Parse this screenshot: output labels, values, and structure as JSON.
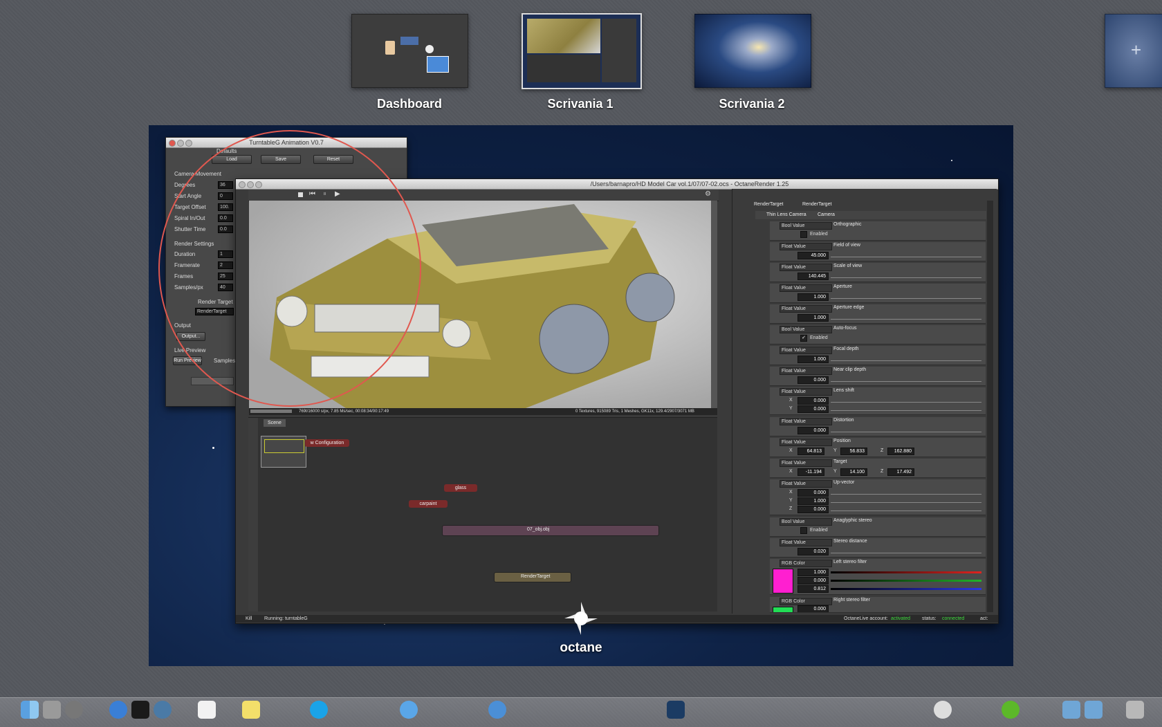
{
  "spaces": [
    {
      "label": "Dashboard"
    },
    {
      "label": "Scrivania 1"
    },
    {
      "label": "Scrivania 2"
    }
  ],
  "turntable": {
    "title": "TurntableG Animation V0.7",
    "defaults_label": "Defaults",
    "buttons": [
      "Load",
      "Save",
      "Reset"
    ],
    "camera_movement_label": "Camera Movement",
    "camera_fields": [
      {
        "label": "Degrees",
        "value": "36"
      },
      {
        "label": "Start Angle",
        "value": "0"
      },
      {
        "label": "Target Offset",
        "value": "100."
      },
      {
        "label": "Spiral In/Out",
        "value": "0.0"
      },
      {
        "label": "Shutter Time",
        "value": "0.0"
      }
    ],
    "render_settings_label": "Render Settings",
    "render_fields": [
      {
        "label": "Duration",
        "value": "1"
      },
      {
        "label": "Framerate",
        "value": "2"
      },
      {
        "label": "Frames",
        "value": "25"
      },
      {
        "label": "Samples/px",
        "value": "40"
      }
    ],
    "render_target_label": "Render Target",
    "render_target_value": "RenderTarget",
    "output_label": "Output",
    "output_button": "Output...",
    "live_preview_label": "Live Preview",
    "run_preview_button": "Run Preview",
    "samples_label": "Samples"
  },
  "octane": {
    "title": "/Users/barnapro/HD Model Car vol.1/07/07-02.ocs - OctaneRender 1.25",
    "render_stats_left": "769t/16000 s/px, 7.85 Ms/sec, 00:08:34/00:17:49",
    "render_stats_right": "0 Textures, 915089 Tris, 1 Meshes, GK11x, 129.4/2907/3071 MB",
    "scene_tab": "Scene",
    "nodes": {
      "config": "w Configuration",
      "glass": "glass",
      "carpaint": "carpaint",
      "obj": "07_obj.obj",
      "render_target": "RenderTarget"
    },
    "status_kill": "Kill",
    "status_running": "Running: turntableG",
    "account_label": "OctaneLive account:",
    "account_status": "activated",
    "status_label": "status:",
    "status_value": "connected",
    "act_label": "act:",
    "inspector_header": {
      "type": "RenderTarget",
      "name": "RenderTarget"
    },
    "camera_header": {
      "type": "Thin Lens Camera",
      "name": "Camera"
    },
    "properties": [
      {
        "type": "Bool Value",
        "name": "Orthographic",
        "check_label": "Enabled",
        "checked": false
      },
      {
        "type": "Float Value",
        "name": "Field of view",
        "value": "45.000"
      },
      {
        "type": "Float Value",
        "name": "Scale of view",
        "value": "140.445"
      },
      {
        "type": "Float Value",
        "name": "Aperture",
        "value": "1.000"
      },
      {
        "type": "Float Value",
        "name": "Aperture edge",
        "value": "1.000"
      },
      {
        "type": "Bool Value",
        "name": "Auto-focus",
        "check_label": "Enabled",
        "checked": true
      },
      {
        "type": "Float Value",
        "name": "Focal depth",
        "value": "1.000"
      },
      {
        "type": "Float Value",
        "name": "Near clip depth",
        "value": "0.000"
      },
      {
        "type": "Float Value",
        "name": "Lens shift",
        "x": "0.000",
        "y": "0.000"
      },
      {
        "type": "Float Value",
        "name": "Distortion",
        "value": "0.000"
      },
      {
        "type": "Float Value",
        "name": "Position",
        "x": "64.813",
        "y": "56.833",
        "z": "162.880"
      },
      {
        "type": "Float Value",
        "name": "Target",
        "x": "-11.194",
        "y": "14.100",
        "z": "17.492"
      },
      {
        "type": "Float Value",
        "name": "Up-vector",
        "x": "0.000",
        "y": "1.000",
        "z": "0.000"
      },
      {
        "type": "Bool Value",
        "name": "Anaglyphic stereo",
        "check_label": "Enabled",
        "checked": false
      },
      {
        "type": "Float Value",
        "name": "Stereo distance",
        "value": "0.020"
      },
      {
        "type": "RGB Color",
        "name": "Left stereo filter",
        "r": "1.000",
        "g": "0.000",
        "b": "0.812"
      },
      {
        "type": "RGB Color",
        "name": "Right stereo filter",
        "r": "0.000"
      }
    ],
    "axis_labels": {
      "x": "X",
      "y": "Y",
      "z": "Z"
    },
    "check_mark": "✓"
  },
  "app_label": "octane",
  "colors": {
    "left_filter": "#ff1fd0",
    "right_filter": "#22dd55",
    "activated": "#3ddc3d",
    "connected": "#3ddc3d"
  }
}
